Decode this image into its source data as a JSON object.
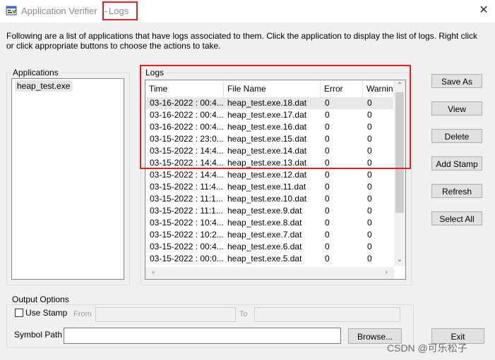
{
  "window": {
    "title_app": "Application Verifier",
    "title_sep": "-",
    "title_logs": "Logs",
    "close_symbol": "✕"
  },
  "instructions": "Following are a list of applications that have logs associated to them. Click the application to display the list of logs. Right click or click appropriate buttons to choose the actions to take.",
  "applications": {
    "label": "Applications",
    "items": [
      "heap_test.exe"
    ]
  },
  "logs": {
    "label": "Logs",
    "columns": [
      "Time",
      "File Name",
      "Error",
      "Warning"
    ],
    "rows": [
      {
        "time": "03-16-2022 : 00:4...",
        "file": "heap_test.exe.18.dat",
        "error": "0",
        "warning": "0"
      },
      {
        "time": "03-16-2022 : 00:4...",
        "file": "heap_test.exe.17.dat",
        "error": "0",
        "warning": "0"
      },
      {
        "time": "03-16-2022 : 00:4...",
        "file": "heap_test.exe.16.dat",
        "error": "0",
        "warning": "0"
      },
      {
        "time": "03-15-2022 : 23:0...",
        "file": "heap_test.exe.15.dat",
        "error": "0",
        "warning": "0"
      },
      {
        "time": "03-15-2022 : 14:4...",
        "file": "heap_test.exe.14.dat",
        "error": "0",
        "warning": "0"
      },
      {
        "time": "03-15-2022 : 14:4...",
        "file": "heap_test.exe.13.dat",
        "error": "0",
        "warning": "0"
      },
      {
        "time": "03-15-2022 : 14:4...",
        "file": "heap_test.exe.12.dat",
        "error": "0",
        "warning": "0"
      },
      {
        "time": "03-15-2022 : 11:4...",
        "file": "heap_test.exe.11.dat",
        "error": "0",
        "warning": "0"
      },
      {
        "time": "03-15-2022 : 11:1...",
        "file": "heap_test.exe.10.dat",
        "error": "0",
        "warning": "0"
      },
      {
        "time": "03-15-2022 : 11:1...",
        "file": "heap_test.exe.9.dat",
        "error": "0",
        "warning": "0"
      },
      {
        "time": "03-15-2022 : 10:4...",
        "file": "heap_test.exe.8.dat",
        "error": "0",
        "warning": "0"
      },
      {
        "time": "03-15-2022 : 10:2...",
        "file": "heap_test.exe.7.dat",
        "error": "0",
        "warning": "0"
      },
      {
        "time": "03-15-2022 : 00:4...",
        "file": "heap_test.exe.6.dat",
        "error": "0",
        "warning": "0"
      },
      {
        "time": "03-15-2022 : 00:0...",
        "file": "heap_test.exe.5.dat",
        "error": "0",
        "warning": "0"
      }
    ]
  },
  "buttons": {
    "save_as": "Save As",
    "view": "View",
    "delete": "Delete",
    "add_stamp": "Add Stamp",
    "refresh": "Refresh",
    "select_all": "Select All",
    "browse": "Browse...",
    "exit": "Exit"
  },
  "output_options": {
    "label": "Output Options",
    "use_stamp": "Use Stamp",
    "from": "From",
    "to": "To",
    "symbol_path": "Symbol Path",
    "symbol_path_value": ""
  },
  "watermark": "CSDN @可乐松子",
  "colors": {
    "highlight": "#e02020",
    "selected_row": "#e8e8e8",
    "dialog_bg": "#f0f0f0"
  }
}
